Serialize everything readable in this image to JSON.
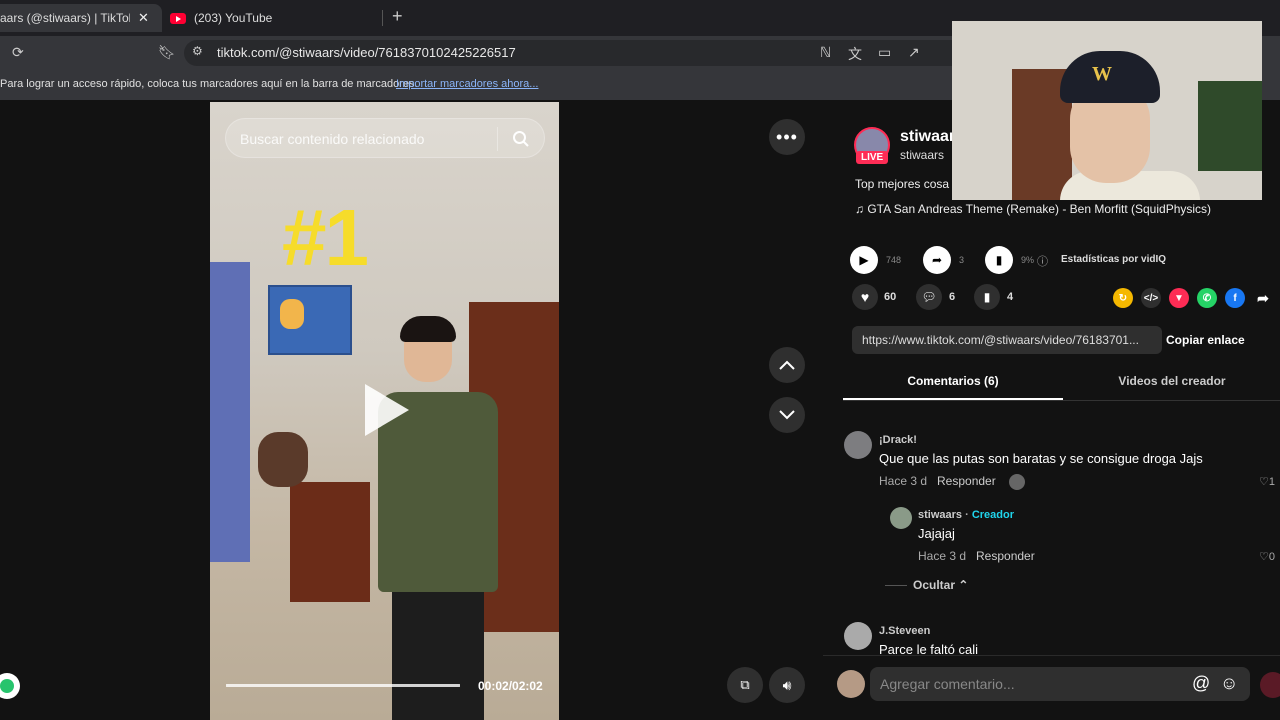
{
  "browser": {
    "tabs": [
      {
        "label": "aars (@stiwaars) | TikTok"
      },
      {
        "label": "(203) YouTube"
      }
    ],
    "url": "tiktok.com/@stiwaars/video/7618370102425226517",
    "bookmarks_message": "Para lograr un acceso rápido, coloca tus marcadores aquí en la barra de marcadores.",
    "bookmarks_link": "Importar marcadores ahora..."
  },
  "video": {
    "search_placeholder": "Buscar contenido relacionado",
    "overlay_text": "#1",
    "time": "00:02/02:02",
    "progress": 1.0
  },
  "creator": {
    "name": "stiwaars",
    "handle": "stiwaars",
    "live_badge": "LIVE",
    "description": "Top mejores cosa",
    "music": "GTA San Andreas Theme (Remake) - Ben Morfitt (SquidPhysics)"
  },
  "stats": {
    "plays": "748",
    "shares": "3",
    "percent": "9%",
    "stats_label": "Estadísticas por vidIQ",
    "likes": "60",
    "comments": "6",
    "saves": "4"
  },
  "link": {
    "value": "https://www.tiktok.com/@stiwaars/video/76183701...",
    "copy_label": "Copiar enlace"
  },
  "tabs": {
    "comments": "Comentarios (6)",
    "creator_videos": "Videos del creador"
  },
  "comments": [
    {
      "user": "¡Drack!",
      "text": "Que que las putas son baratas y se consigue droga Jajs",
      "time": "Hace 3 d",
      "reply": "Responder",
      "likes": "1"
    },
    {
      "user": "stiwaars",
      "creator_tag": "Creador",
      "text": "Jajajaj",
      "time": "Hace 3 d",
      "reply": "Responder",
      "likes": "0"
    },
    {
      "user": "J.Steveen",
      "text": "Parce le faltó cali"
    }
  ],
  "hide_label": "Ocultar",
  "comment_input_placeholder": "Agregar comentario...",
  "colors": {
    "accent": "#fe2c55",
    "creator": "#20d5ec",
    "bg": "#121212"
  }
}
